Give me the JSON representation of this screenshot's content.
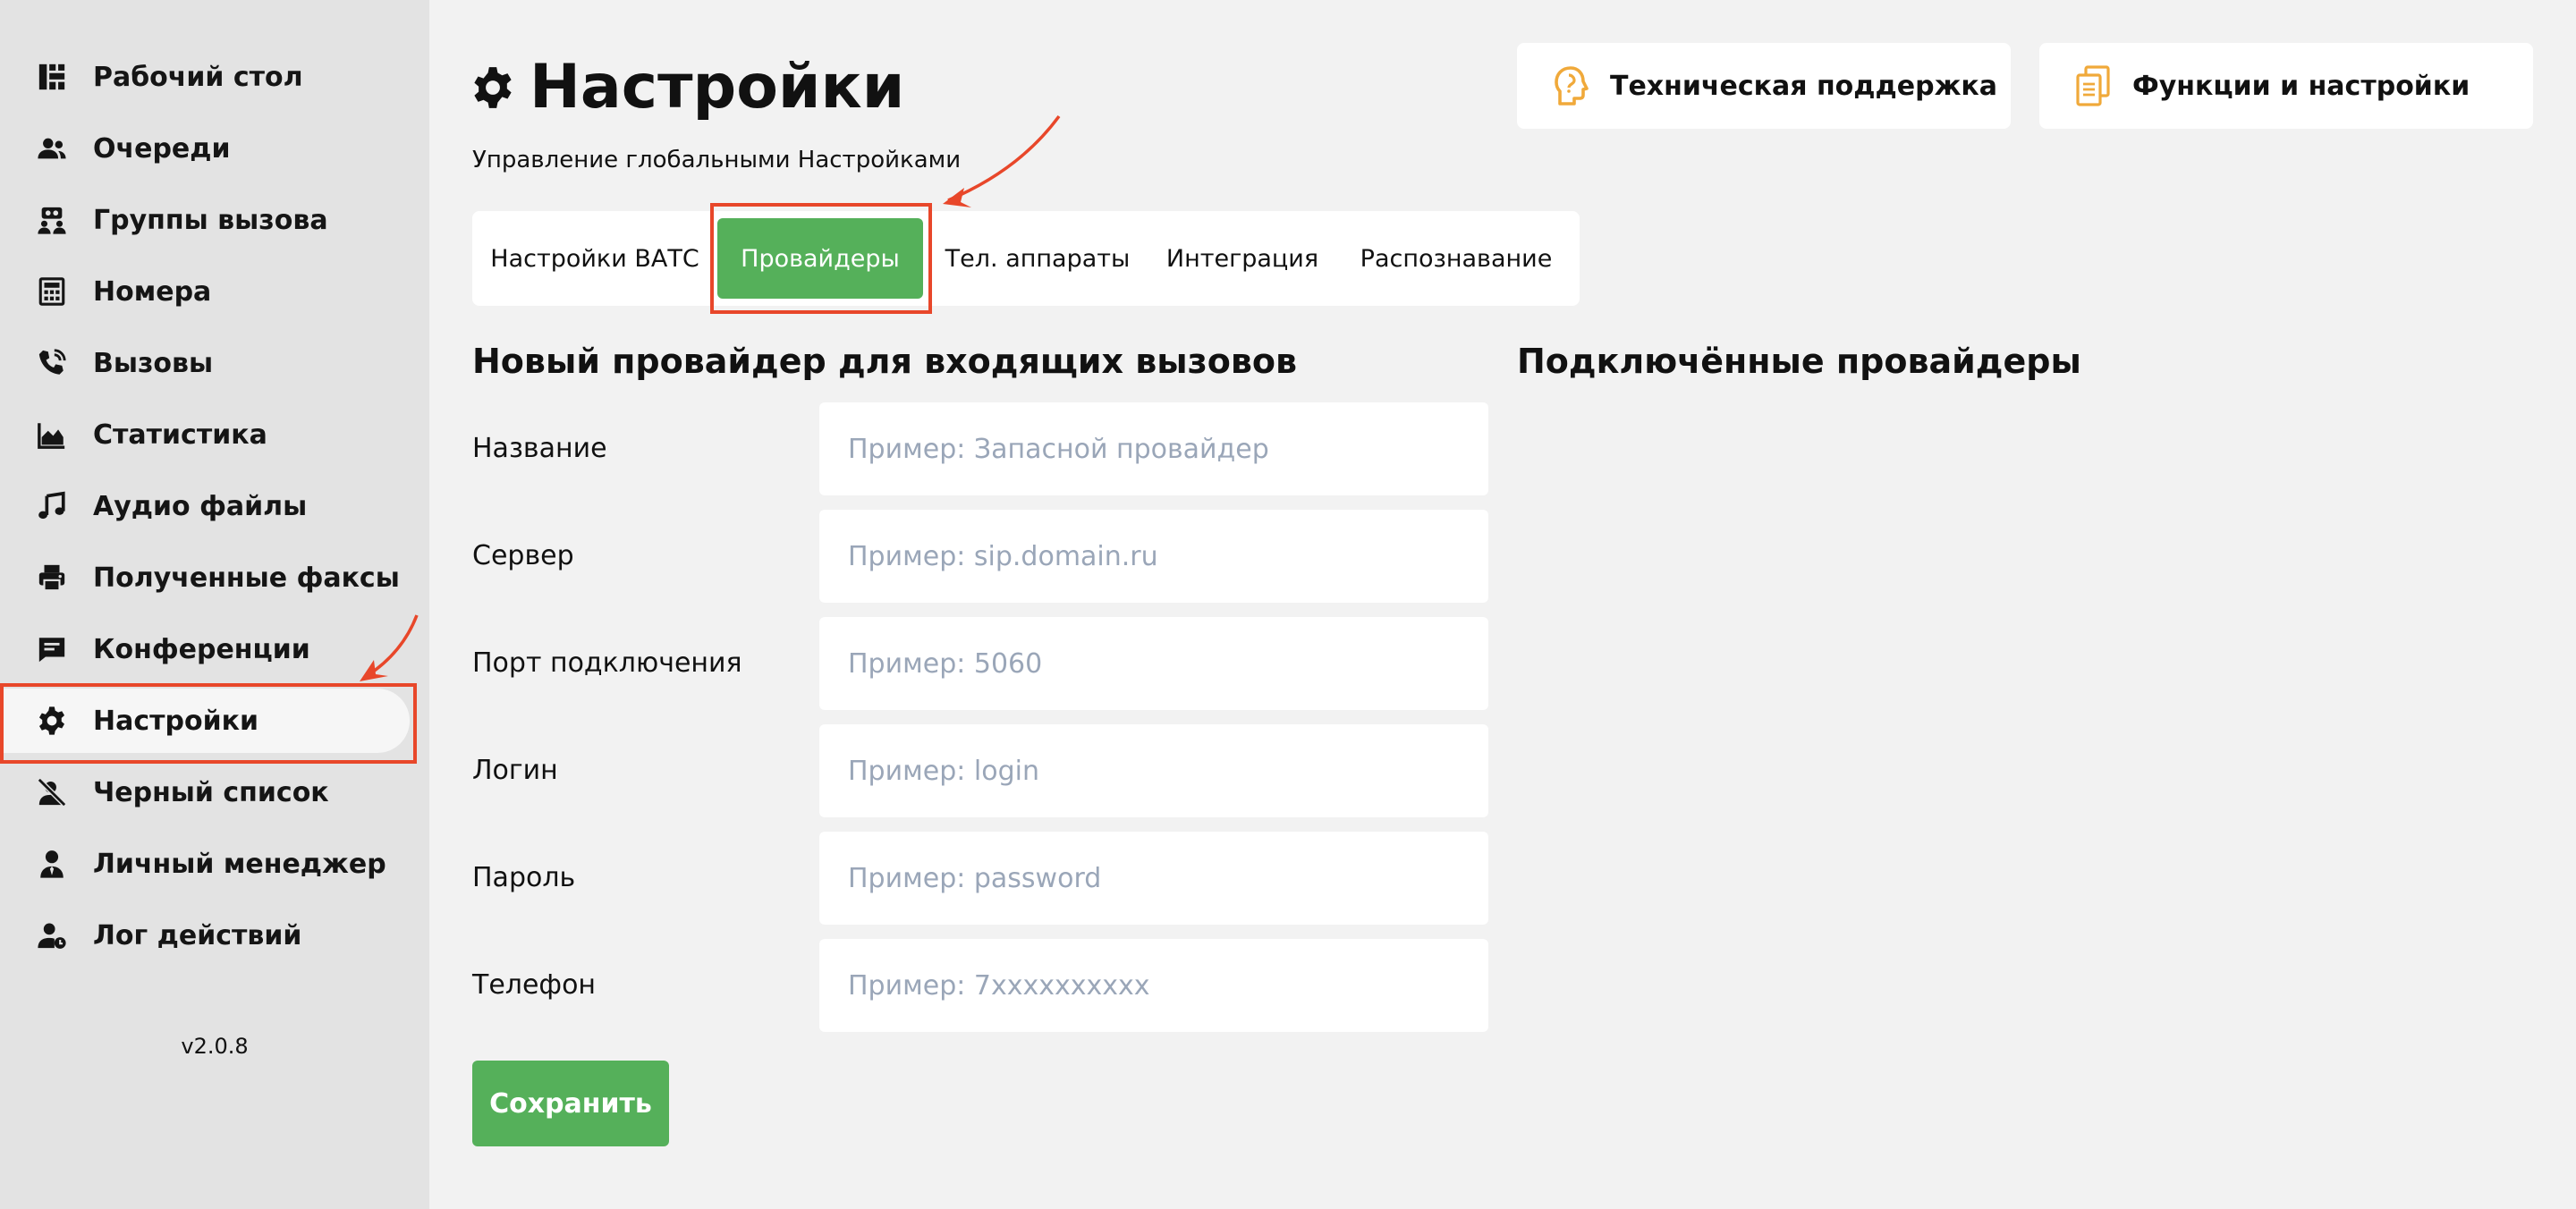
{
  "sidebar": {
    "items": [
      {
        "label": "Рабочий стол",
        "icon": "dashboard-icon"
      },
      {
        "label": "Очереди",
        "icon": "users-icon"
      },
      {
        "label": "Группы вызова",
        "icon": "call-group-icon"
      },
      {
        "label": "Номера",
        "icon": "calculator-icon"
      },
      {
        "label": "Вызовы",
        "icon": "phone-ringing-icon"
      },
      {
        "label": "Статистика",
        "icon": "area-chart-icon"
      },
      {
        "label": "Аудио файлы",
        "icon": "music-note-icon"
      },
      {
        "label": "Полученные факсы",
        "icon": "printer-icon"
      },
      {
        "label": "Конференции",
        "icon": "chat-icon"
      },
      {
        "label": "Настройки",
        "icon": "gear-icon",
        "active": true
      },
      {
        "label": "Черный список",
        "icon": "user-blocked-icon"
      },
      {
        "label": "Личный менеджер",
        "icon": "manager-icon"
      },
      {
        "label": "Лог действий",
        "icon": "user-log-icon"
      }
    ],
    "version": "v2.0.8"
  },
  "header": {
    "title": "Настройки",
    "subtitle": "Управление глобальными Настройками",
    "support_label": "Техническая поддержка",
    "functions_label": "Функции и настройки"
  },
  "tabs": [
    {
      "label": "Настройки ВАТС"
    },
    {
      "label": "Провайдеры",
      "active": true
    },
    {
      "label": "Тел. аппараты"
    },
    {
      "label": "Интеграция"
    },
    {
      "label": "Распознавание"
    }
  ],
  "form": {
    "title": "Новый провайдер для входящих вызовов",
    "fields": [
      {
        "label": "Название",
        "placeholder": "Пример: Запасной провайдер",
        "value": ""
      },
      {
        "label": "Сервер",
        "placeholder": "Пример: sip.domain.ru",
        "value": ""
      },
      {
        "label": "Порт подключения",
        "placeholder": "Пример: 5060",
        "value": ""
      },
      {
        "label": "Логин",
        "placeholder": "Пример: login",
        "value": ""
      },
      {
        "label": "Пароль",
        "placeholder": "Пример: password",
        "value": ""
      },
      {
        "label": "Телефон",
        "placeholder": "Пример: 7xxxxxxxxxx",
        "value": ""
      }
    ],
    "save_label": "Сохранить"
  },
  "connected": {
    "title": "Подключённые провайдеры"
  },
  "colors": {
    "accent_green": "#55b05a",
    "highlight_red": "#e8472a",
    "icon_orange": "#f0a93a",
    "sidebar_bg": "#e3e3e3",
    "page_bg": "#f2f2f2"
  }
}
